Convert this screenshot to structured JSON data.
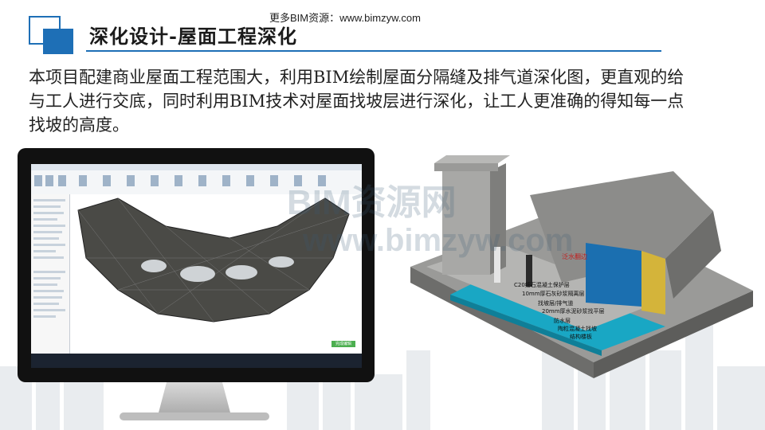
{
  "header": {
    "title": "深化设计-屋面工程深化",
    "source_text": "更多BIM资源：www.bimzyw.com"
  },
  "body": {
    "paragraph": "本项目配建商业屋面工程范围大，利用BIM绘制屋面分隔缝及排气道深化图，更直观的给与工人进行交底，同时利用BIM技术对屋面找坡层进行深化，让工人更准确的得知每一点找坡的高度。"
  },
  "model": {
    "labels": [
      "泛水翻边",
      "C20细石混凝土保护层",
      "10mm厚石灰砂浆隔离层",
      "找坡层/排气道",
      "20mm厚水泥砂浆找平层",
      "防水层",
      "陶粒混凝土找坡",
      "结构楼板"
    ],
    "watermark_cn": "BIM资源网",
    "watermark_en": "www.bimzyw.com"
  },
  "screen": {
    "button_label": "完成编辑"
  },
  "colors": {
    "accent": "#1e6fb6",
    "roof_dark": "#4a4a46",
    "cyan_layer": "#19a7c4"
  }
}
